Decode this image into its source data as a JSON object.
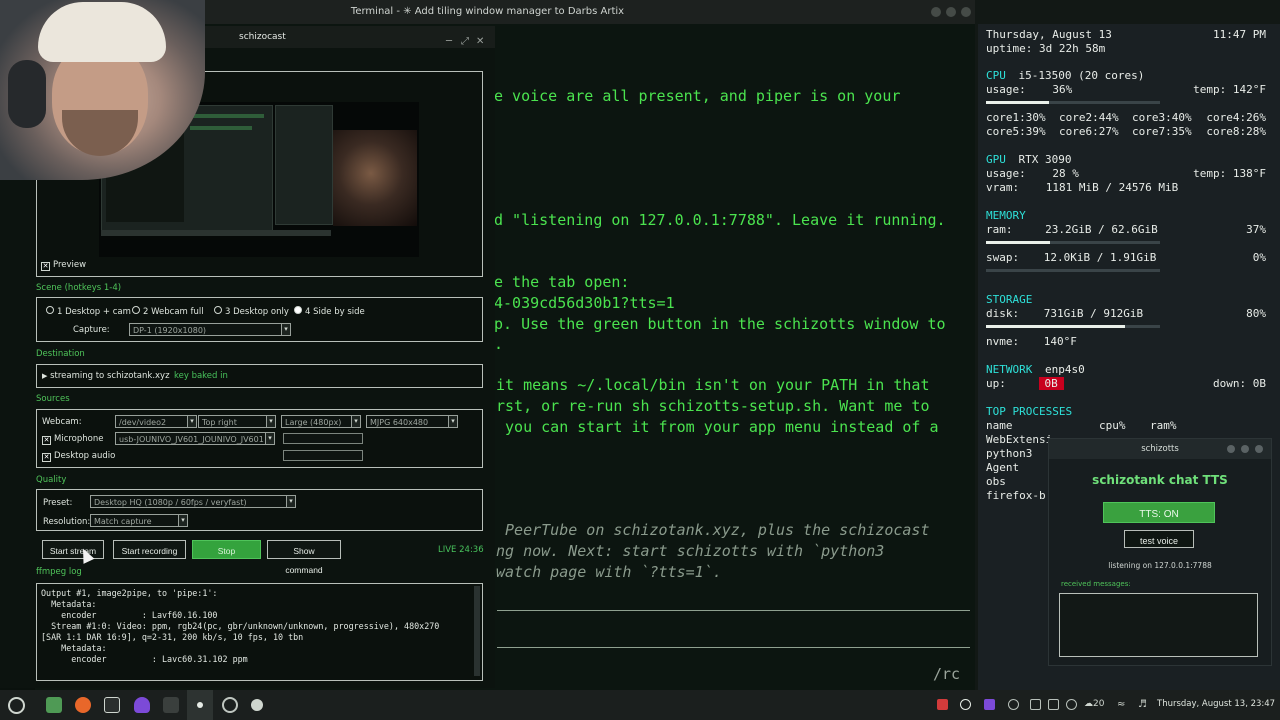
{
  "terminal": {
    "title": "Terminal - ✳ Add tiling window manager to Darbs Artix",
    "lines": [
      {
        "text": "e voice are all present, and piper is on your",
        "style": "green"
      },
      {
        "text": "d \"listening on 127.0.0.1:7788\". Leave it running.",
        "style": "green"
      },
      {
        "text": "e the tab open:",
        "style": "green"
      },
      {
        "text": "4-039cd56d30b1?tts=1",
        "style": "green"
      },
      {
        "text": "p. Use the green button in the schizotts window to",
        "style": "green"
      },
      {
        "text": ".",
        "style": "green"
      },
      {
        "text": "it means ~/.local/bin isn't on your PATH in that",
        "style": "green"
      },
      {
        "text": "rst, or re-run sh schizotts-setup.sh. Want me to",
        "style": "green"
      },
      {
        "text": " you can start it from your app menu instead of a",
        "style": "green"
      },
      {
        "text": " PeerTube on schizotank.xyz, plus the schizocast",
        "style": "italic"
      },
      {
        "text": "ng now. Next: start schizotts with `python3",
        "style": "italic"
      },
      {
        "text": "watch page with `?tts=1`.",
        "style": "italic"
      }
    ],
    "prompt_fragment": "/rc"
  },
  "sysinfo": {
    "date": "Thursday, August 13",
    "time": "11:47 PM",
    "uptime": "uptime: 3d 22h 58m",
    "cpu": {
      "header": "CPU",
      "model": "i5-13500 (20 cores)",
      "usage_label": "usage:",
      "usage": "36%",
      "usage_frac": 0.36,
      "temp_label": "temp:",
      "temp": "142°F",
      "cores": [
        [
          "core1:30%",
          "core2:44%",
          "core3:40%",
          "core4:26%"
        ],
        [
          "core5:39%",
          "core6:27%",
          "core7:35%",
          "core8:28%"
        ]
      ]
    },
    "gpu": {
      "header": "GPU",
      "model": "RTX 3090",
      "usage_label": "usage:",
      "usage": "28 %",
      "usage_frac": 0.28,
      "temp_label": "temp:",
      "temp": "138°F",
      "vram_label": "vram:",
      "vram": "1181 MiB / 24576 MiB"
    },
    "memory": {
      "header": "MEMORY",
      "ram_label": "ram:",
      "ram": "23.2GiB / 62.6GiB",
      "ram_pct": "37%",
      "ram_frac": 0.37,
      "swap_label": "swap:",
      "swap": "12.0KiB / 1.91GiB",
      "swap_pct": "0%",
      "swap_frac": 0.0
    },
    "storage": {
      "header": "STORAGE",
      "disk_label": "disk:",
      "disk": "731GiB / 912GiB",
      "disk_pct": "80%",
      "disk_frac": 0.8,
      "nvme_label": "nvme:",
      "nvme": "140°F"
    },
    "network": {
      "header": "NETWORK",
      "iface": "enp4s0",
      "up_label": "up:",
      "up": "0B",
      "down_label": "down:",
      "down": "0B"
    },
    "processes": {
      "header": "TOP PROCESSES",
      "col_name": "name",
      "col_cpu": "cpu%",
      "col_ram": "ram%",
      "items": [
        "WebExtensi",
        "python3",
        "Agent",
        "obs",
        "firefox-b"
      ]
    }
  },
  "schizocast": {
    "title": "schizocast",
    "preview_label": "Preview",
    "scene": {
      "label": "Scene (hotkeys 1-4)",
      "options": [
        "1 Desktop + cam",
        "2 Webcam full",
        "3 Desktop only",
        "4 Side by side"
      ],
      "selected_index": 3,
      "capture_label": "Capture:",
      "capture_value": "DP-1 (1920x1080)"
    },
    "destination": {
      "label": "Destination",
      "target": "streaming to schizotank.xyz",
      "note": "key baked in"
    },
    "sources": {
      "label": "Sources",
      "webcam_label": "Webcam:",
      "webcam_device": "/dev/video2",
      "webcam_position": "Top right",
      "webcam_size": "Large (480px)",
      "webcam_format": "MJPG 640x480",
      "mic_label": "Microphone",
      "mic_device": "usb-JOUNIVO_JV601_JOUNIVO_JV601",
      "desktop_audio_label": "Desktop audio"
    },
    "quality": {
      "label": "Quality",
      "preset_label": "Preset:",
      "preset_value": "Desktop HQ (1080p / 60fps / veryfast)",
      "resolution_label": "Resolution:",
      "resolution_value": "Match capture"
    },
    "buttons": {
      "start_stream": "Start stream",
      "start_recording": "Start recording",
      "stop": "Stop",
      "show_command": "Show command"
    },
    "live_status": "LIVE 24:36",
    "log_label": "ffmpeg log",
    "log_lines": [
      "Output #1, image2pipe, to 'pipe:1':",
      "  Metadata:",
      "    encoder         : Lavf60.16.100",
      "  Stream #1:0: Video: ppm, rgb24(pc, gbr/unknown/unknown, progressive), 480x270",
      "[SAR 1:1 DAR 16:9], q=2-31, 200 kb/s, 10 fps, 10 tbn",
      "    Metadata:",
      "      encoder         : Lavc60.31.102 ppm"
    ]
  },
  "schizotts": {
    "title": "schizotts",
    "heading": "schizotank chat TTS",
    "tts_button": "TTS: ON",
    "test_button": "test voice",
    "listening": "listening on 127.0.0.1:7788",
    "received_label": "received messages:"
  },
  "taskbar": {
    "clock": "Thursday, August 13, 23:47",
    "weather": "20"
  },
  "colors": {
    "terminal_green": "#4be34f",
    "conky_head": "#2ee0d8",
    "accent_green": "#34a33d"
  }
}
